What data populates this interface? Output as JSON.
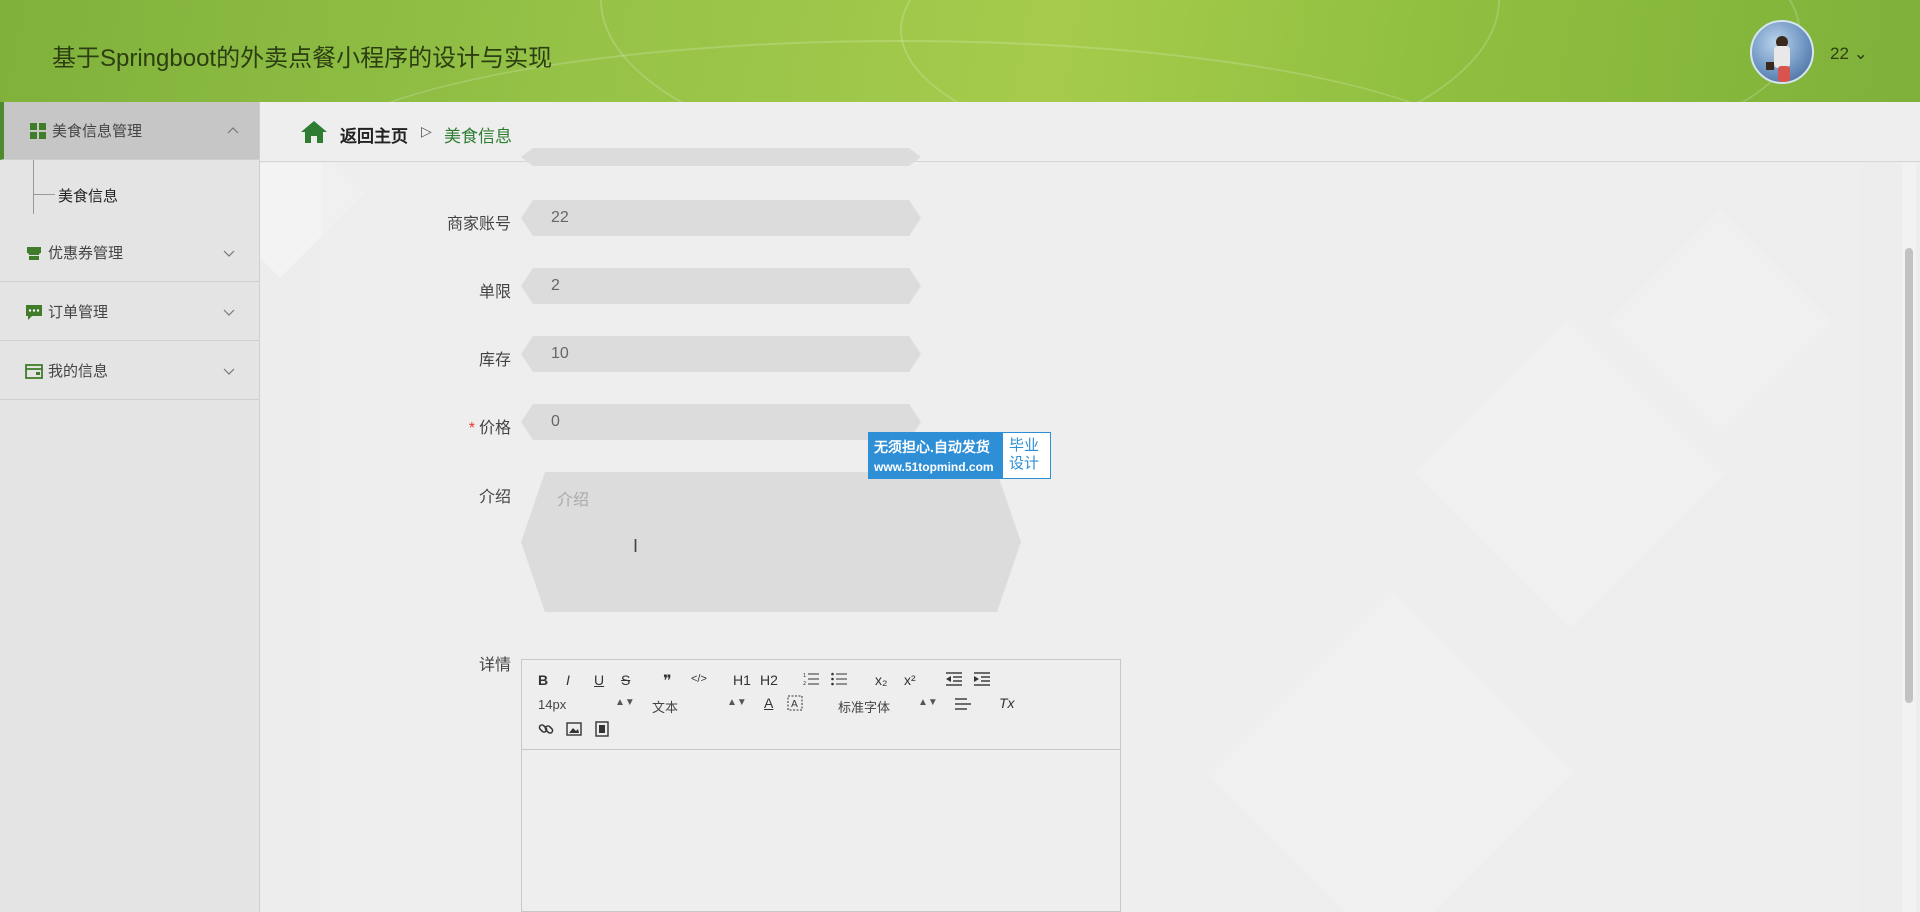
{
  "header": {
    "title": "基于Springboot的外卖点餐小程序的设计与实现",
    "user": "22 ⌄"
  },
  "sidebar": {
    "items": [
      {
        "label": "美食信息管理",
        "icon": "grid-icon",
        "expanded": true,
        "children": [
          "美食信息"
        ]
      },
      {
        "label": "优惠券管理",
        "icon": "coupon-icon"
      },
      {
        "label": "订单管理",
        "icon": "chat-icon"
      },
      {
        "label": "我的信息",
        "icon": "card-icon"
      }
    ]
  },
  "breadcrumb": {
    "home": "返回主页",
    "separator": "▷",
    "current": "美食信息"
  },
  "form": {
    "merchant_label": "商家账号",
    "merchant_value": "22",
    "limit_label": "单限",
    "limit_value": "2",
    "stock_label": "库存",
    "stock_value": "10",
    "price_required": "*",
    "price_label": "价格",
    "price_value": "0",
    "intro_label": "介绍",
    "intro_placeholder": "介绍",
    "detail_label": "详情"
  },
  "badge": {
    "line1": "无须担心.自动发货",
    "line2": "www.51topmind.com",
    "right1": "毕业",
    "right2": "设计"
  },
  "editor": {
    "bold": "B",
    "italic": "I",
    "underline": "U",
    "strike": "S",
    "quote": "❞",
    "code": "</>",
    "h1": "H1",
    "h2": "H2",
    "sub": "x₂",
    "sup": "x²",
    "font_size": "14px",
    "text_type": "文本",
    "font_family": "标准字体",
    "color_a": "A",
    "clear": "Tx"
  },
  "colors": {
    "header_green": "#95c247",
    "accent_green": "#2e7d32",
    "badge_blue": "#2f8fd6"
  }
}
